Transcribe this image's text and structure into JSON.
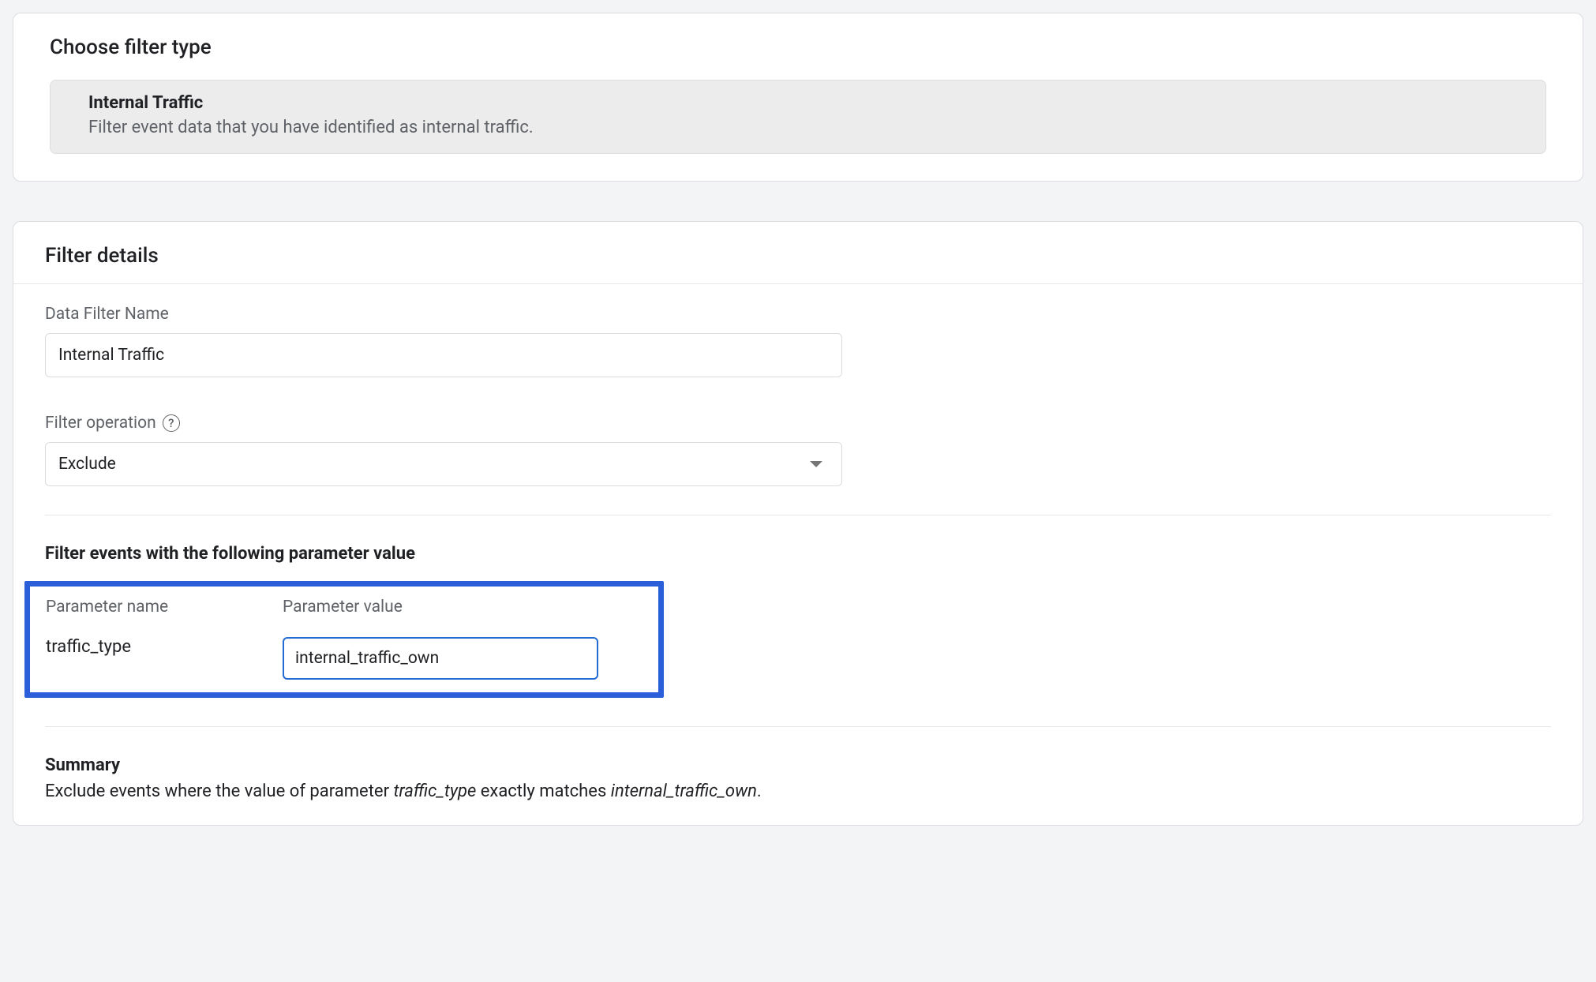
{
  "choose": {
    "title": "Choose filter type",
    "option": {
      "title": "Internal Traffic",
      "desc": "Filter event data that you have identified as internal traffic."
    }
  },
  "details": {
    "title": "Filter details",
    "name_label": "Data Filter Name",
    "name_value": "Internal Traffic",
    "operation_label": "Filter operation",
    "operation_value": "Exclude",
    "param_section_title": "Filter events with the following parameter value",
    "param_name_label": "Parameter name",
    "param_value_label": "Parameter value",
    "param_name": "traffic_type",
    "param_value": "internal_traffic_own",
    "summary_title": "Summary",
    "summary_prefix": "Exclude events where the value of parameter ",
    "summary_param_name": "traffic_type",
    "summary_mid": " exactly matches ",
    "summary_param_value": "internal_traffic_own",
    "summary_suffix": "."
  },
  "icons": {
    "help": "?"
  }
}
